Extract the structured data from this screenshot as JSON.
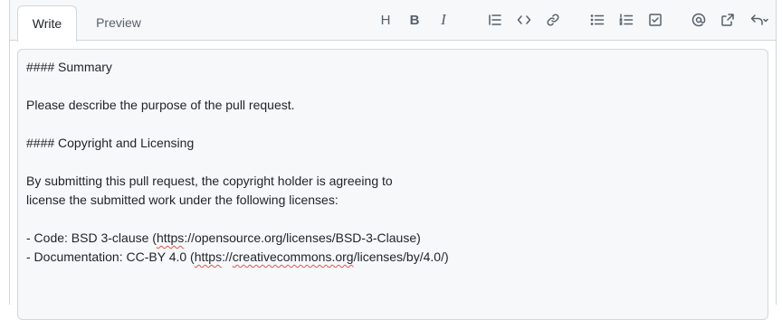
{
  "tabs": {
    "write": "Write",
    "preview": "Preview"
  },
  "toolbar": {
    "heading": "H",
    "bold": "B",
    "italic": "I"
  },
  "editor": {
    "lines": [
      "#### Summary",
      "",
      "Please describe the purpose of the pull request.",
      "",
      "#### Copyright and Licensing",
      "",
      "By submitting this pull request, the copyright holder is agreeing to",
      "license the submitted work under the following licenses:",
      "",
      "- Code: BSD 3-clause (https://opensource.org/licenses/BSD-3-Clause)",
      "- Documentation: CC-BY 4.0 (https://creativecommons.org/licenses/by/4.0/)"
    ],
    "code_prefix": "- Code: BSD 3-clause (",
    "code_url_a": "https",
    "code_url_b": "://opensource.org/licenses/BSD-3-Clause)",
    "doc_prefix": "- Documentation: CC-BY 4.0 (",
    "doc_url_a": "https",
    "doc_url_b": "://",
    "doc_url_c": "creativecommons.org",
    "doc_url_d": "/licenses/by/4.0/)"
  },
  "icons": [
    "heading-icon",
    "bold-icon",
    "italic-icon",
    "quote-icon",
    "code-icon",
    "link-icon",
    "unordered-list-icon",
    "ordered-list-icon",
    "task-list-icon",
    "mention-icon",
    "cross-reference-icon",
    "reply-icon"
  ]
}
